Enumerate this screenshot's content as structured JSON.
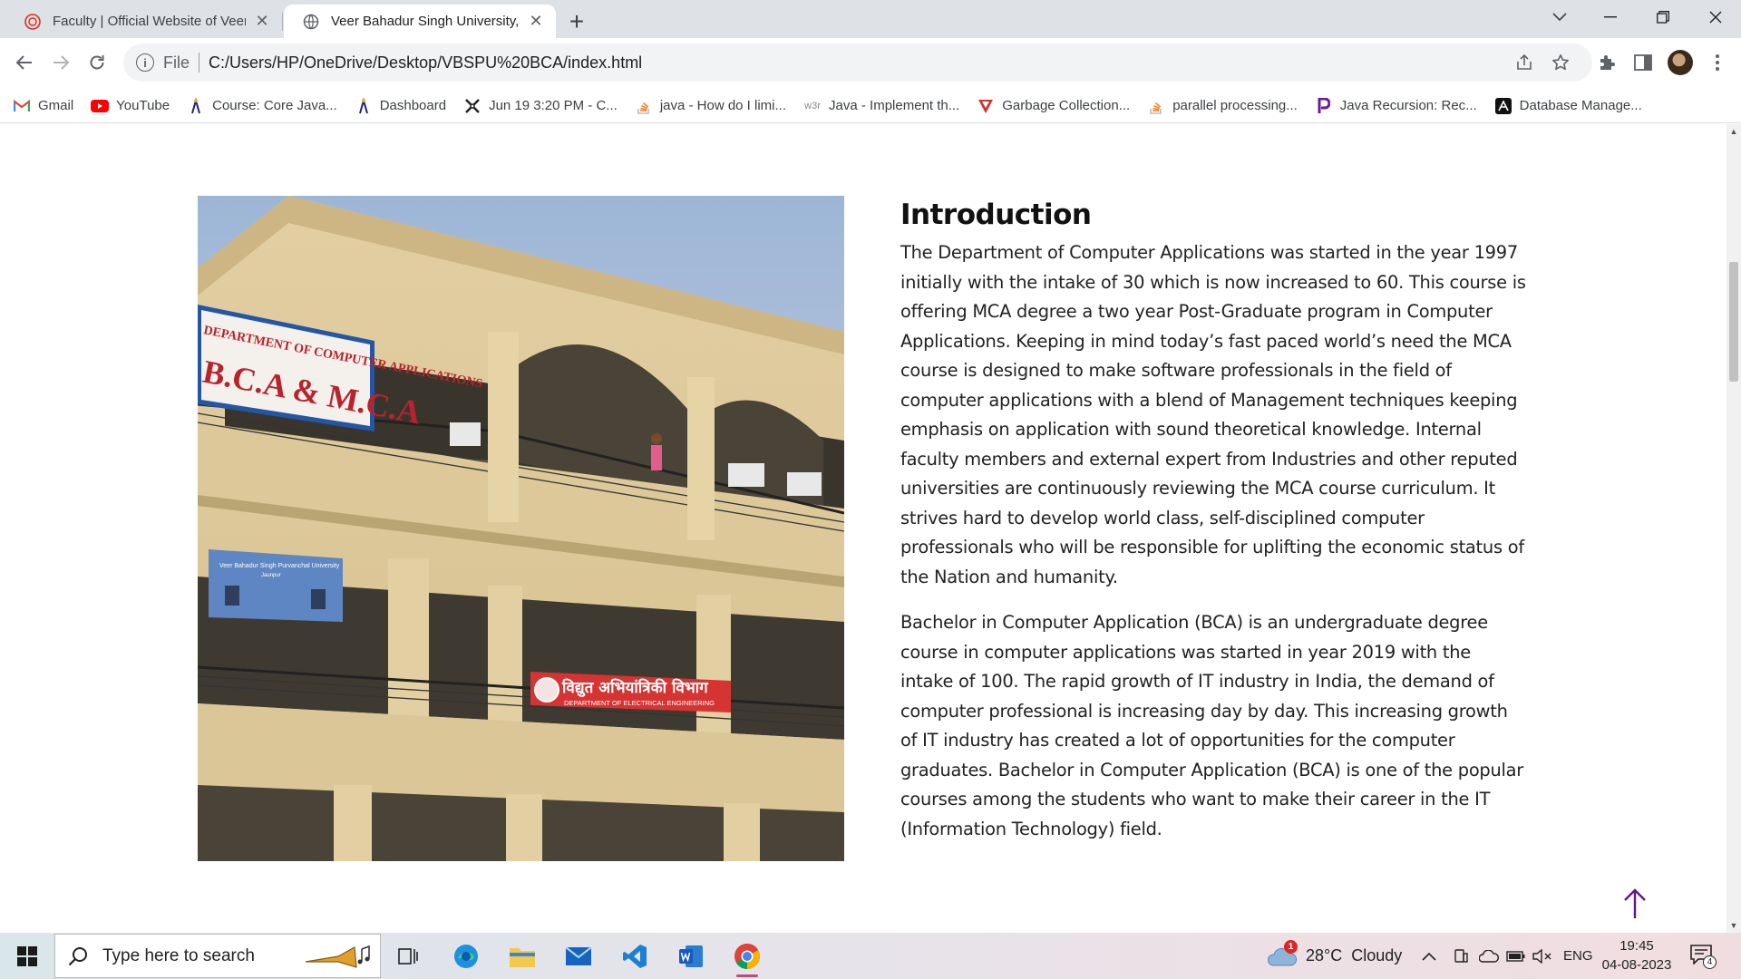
{
  "browser": {
    "tabs": [
      {
        "title": "Faculty | Official Website of Veer"
      },
      {
        "title": "Veer Bahadur Singh University,Ja"
      }
    ],
    "omnibox": {
      "scheme": "File",
      "url": "C:/Users/HP/OneDrive/Desktop/VBSPU%20BCA/index.html"
    },
    "bookmarks": [
      {
        "label": "Gmail",
        "icon": "gmail-icon",
        "color": "#ea4335"
      },
      {
        "label": "YouTube",
        "icon": "youtube-icon",
        "color": "#ff0000"
      },
      {
        "label": "Course: Core Java...",
        "icon": "moodle-icon",
        "color": "#1a237e"
      },
      {
        "label": "Dashboard",
        "icon": "moodle-icon",
        "color": "#1a237e"
      },
      {
        "label": "Jun 19 3:20 PM - C...",
        "icon": "link-icon",
        "color": "#222222"
      },
      {
        "label": "java - How do I limi...",
        "icon": "stackoverflow-icon",
        "color": "#f48024"
      },
      {
        "label": "Java - Implement th...",
        "icon": "w3r-icon",
        "color": "#777777"
      },
      {
        "label": "Garbage Collection...",
        "icon": "geeks-icon",
        "color": "#d32f2f"
      },
      {
        "label": "parallel processing...",
        "icon": "stackoverflow-icon",
        "color": "#f48024"
      },
      {
        "label": "Java Recursion: Rec...",
        "icon": "p-icon",
        "color": "#6a1b9a"
      },
      {
        "label": "Database Manage...",
        "icon": "db-icon",
        "color": "#111111"
      }
    ]
  },
  "page": {
    "intro": {
      "heading": "Introduction",
      "paragraphs": [
        "The Department of Computer Applications was started in the year 1997 initially with the intake of 30 which is now increased to 60. This course is offering MCA degree a two year Post-Graduate program in Computer Applications. Keeping in mind today’s fast paced world’s need the MCA course is designed to make software professionals in the field of computer applications with a blend of Management techniques keeping emphasis on application with sound theoretical knowledge. Internal faculty members and external expert from Industries and other reputed universities are continuously reviewing the MCA course curriculum. It strives hard to develop world class, self-disciplined computer professionals who will be responsible for uplifting the economic status of the Nation and humanity.",
        "Bachelor in Computer Application (BCA) is an undergraduate degree course in computer applications was started in year 2019 with the intake of 100. The rapid growth of IT industry in India, the demand of computer professional is increasing day by day. This increasing growth of IT industry has created a lot of opportunities for the computer graduates. Bachelor in Computer Application (BCA) is one of the popular courses among the students who want to make their career in the IT (Information Technology) field."
      ]
    },
    "photo": {
      "sign_top": "DEPARTMENT OF COMPUTER APPLICATIONS",
      "sign_main": "B.C.A & M.C.A",
      "board_title": "Veer Bahadur Singh Purvanchal University",
      "board_sub": "Jaunpur",
      "banner_hindi": "विद्युत अभियांत्रिकी विभाग",
      "banner_eng": "DEPARTMENT OF ELECTRICAL ENGINEERING"
    }
  },
  "taskbar": {
    "search_placeholder": "Type here to search",
    "weather": {
      "temp": "28°C",
      "condition": "Cloudy",
      "alert_count": "1"
    },
    "lang": "ENG",
    "time": "19:45",
    "date": "04-08-2023",
    "notifications": "4"
  }
}
